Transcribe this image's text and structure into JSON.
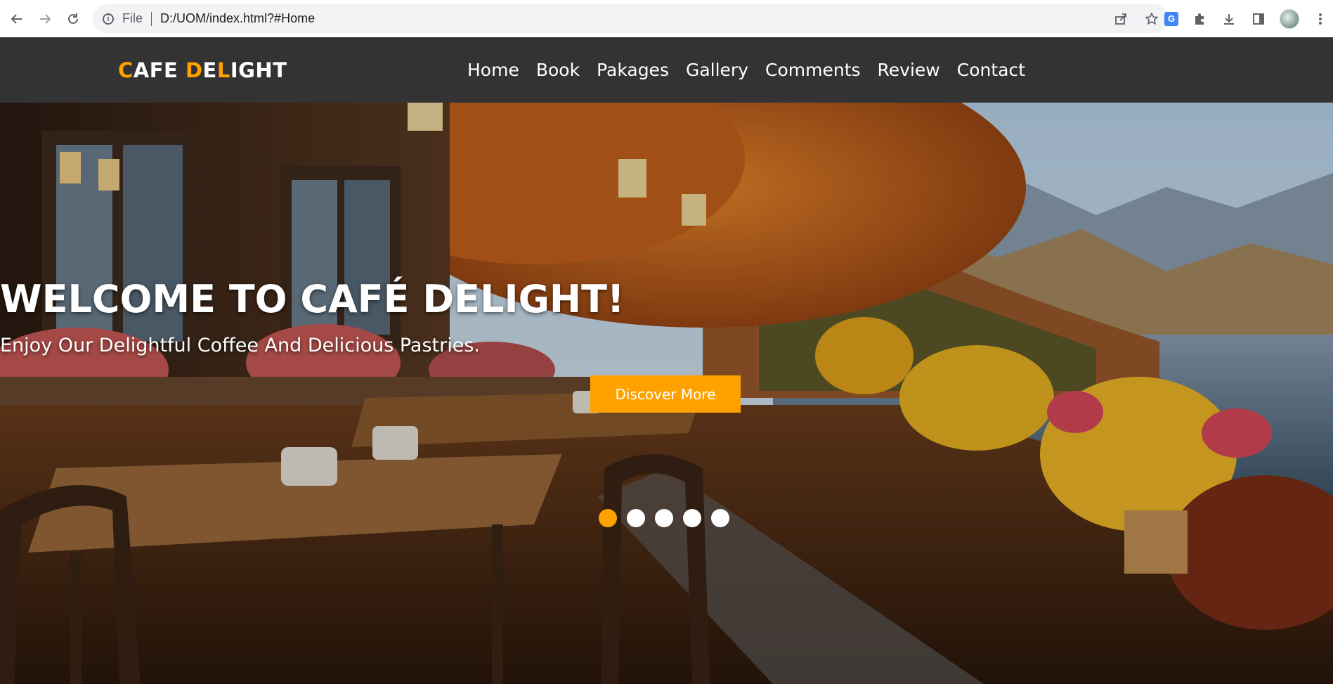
{
  "browser": {
    "scheme": "File",
    "url": "D:/UOM/index.html?#Home",
    "icons": [
      "back-arrow-icon",
      "forward-arrow-icon",
      "reload-icon",
      "info-icon",
      "share-icon",
      "star-icon",
      "translate-icon",
      "extensions-icon",
      "download-icon",
      "sidepanel-icon",
      "avatar",
      "menu-icon"
    ]
  },
  "header": {
    "logo_part1": "CAFE ",
    "logo_part2": "DELIGHT",
    "nav": [
      "Home",
      "Book",
      "Pakages",
      "Gallery",
      "Comments",
      "Review",
      "Contact"
    ]
  },
  "hero": {
    "title": "WELCOME TO CAFÉ DELIGHT!",
    "subtitle": "Enjoy Our Delightful Coffee And Delicious Pastries.",
    "button_label": "Discover More",
    "slides_total": 5,
    "active_slide": 1
  },
  "colors": {
    "accent": "#ffa200",
    "header_bg": "#333333",
    "text_light": "#ffffff"
  }
}
